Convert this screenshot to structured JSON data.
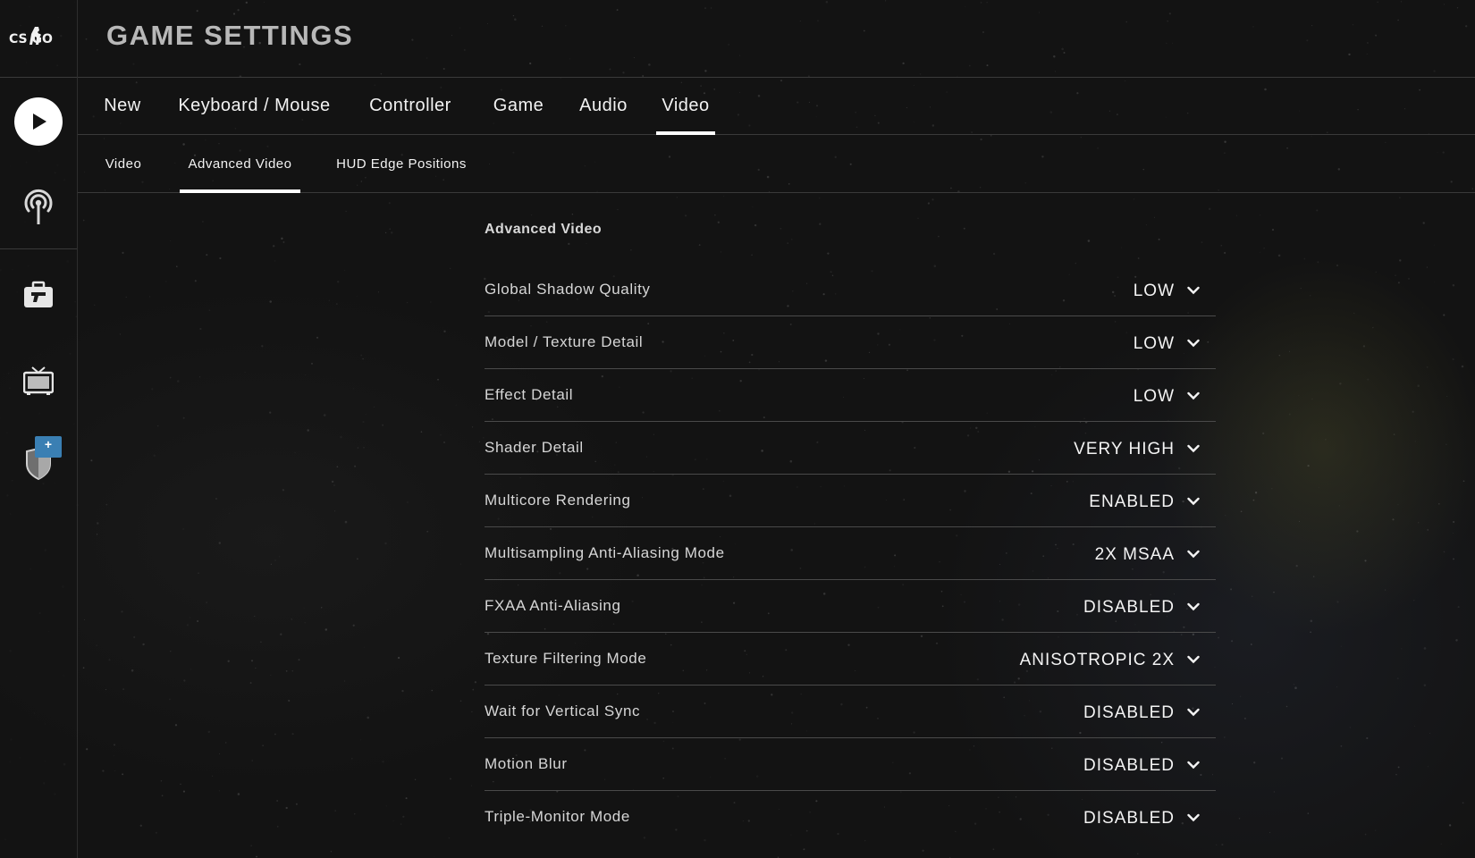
{
  "app": {
    "logo_text": "CS GO"
  },
  "header": {
    "title": "GAME SETTINGS"
  },
  "sidebar": {
    "badge": "+"
  },
  "tabs": [
    {
      "label": "New"
    },
    {
      "label": "Keyboard / Mouse"
    },
    {
      "label": "Controller"
    },
    {
      "label": "Game"
    },
    {
      "label": "Audio"
    },
    {
      "label": "Video"
    }
  ],
  "active_tab": "Video",
  "subtabs": [
    {
      "label": "Video"
    },
    {
      "label": "Advanced Video"
    },
    {
      "label": "HUD Edge Positions"
    }
  ],
  "active_subtab": "Advanced Video",
  "section": {
    "title": "Advanced Video"
  },
  "settings": [
    {
      "label": "Global Shadow Quality",
      "value": "LOW"
    },
    {
      "label": "Model / Texture Detail",
      "value": "LOW"
    },
    {
      "label": "Effect Detail",
      "value": "LOW"
    },
    {
      "label": "Shader Detail",
      "value": "VERY HIGH"
    },
    {
      "label": "Multicore Rendering",
      "value": "ENABLED"
    },
    {
      "label": "Multisampling Anti-Aliasing Mode",
      "value": "2X MSAA"
    },
    {
      "label": "FXAA Anti-Aliasing",
      "value": "DISABLED"
    },
    {
      "label": "Texture Filtering Mode",
      "value": "ANISOTROPIC 2X"
    },
    {
      "label": "Wait for Vertical Sync",
      "value": "DISABLED"
    },
    {
      "label": "Motion Blur",
      "value": "DISABLED"
    },
    {
      "label": "Triple-Monitor Mode",
      "value": "DISABLED"
    }
  ],
  "colors": {
    "background": "#131313",
    "accent": "#ffffff",
    "badge": "#3a7fb3",
    "title_gray": "#b8b8b8"
  },
  "icons": {
    "play": "play-icon",
    "watch": "broadcast-icon",
    "inventory": "briefcase-icon",
    "tv": "tv-icon",
    "rank": "shield-icon",
    "dropdown": "chevron-down-icon"
  }
}
